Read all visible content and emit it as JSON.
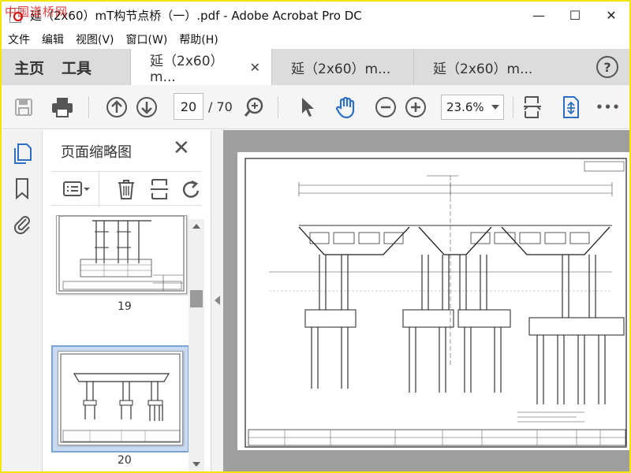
{
  "window": {
    "title": "延（2x60）mT构节点桥（一）.pdf - Adobe Acrobat Pro DC",
    "watermark": "中国道桥网",
    "minimize_glyph": "—",
    "restore_glyph": "☐",
    "close_glyph": "✕"
  },
  "menu": {
    "items": [
      "文件",
      "编辑",
      "视图(V)",
      "窗口(W)",
      "帮助(H)"
    ]
  },
  "tabs": {
    "home": "主页",
    "tools": "工具",
    "documents": [
      {
        "label": "延（2x60）m...",
        "close": "✕",
        "active": true
      },
      {
        "label": "延（2x60）m...",
        "close": "",
        "active": false
      },
      {
        "label": "延（2x60）m...",
        "close": "",
        "active": false
      }
    ],
    "help": "?"
  },
  "toolbar": {
    "page_current": "20",
    "page_total": "/ 70",
    "zoom": "23.6%",
    "more": "•••"
  },
  "panel": {
    "title": "页面缩略图",
    "close": "✕",
    "thumbnails": [
      {
        "page": "19"
      },
      {
        "page": "20"
      }
    ]
  },
  "colors": {
    "accent": "#2d6fc2",
    "window_border": "#f2e500",
    "tabbar": "#dcdcdc",
    "doc_background": "#9f9f9f",
    "thumb_selection": "#c9daf1"
  }
}
